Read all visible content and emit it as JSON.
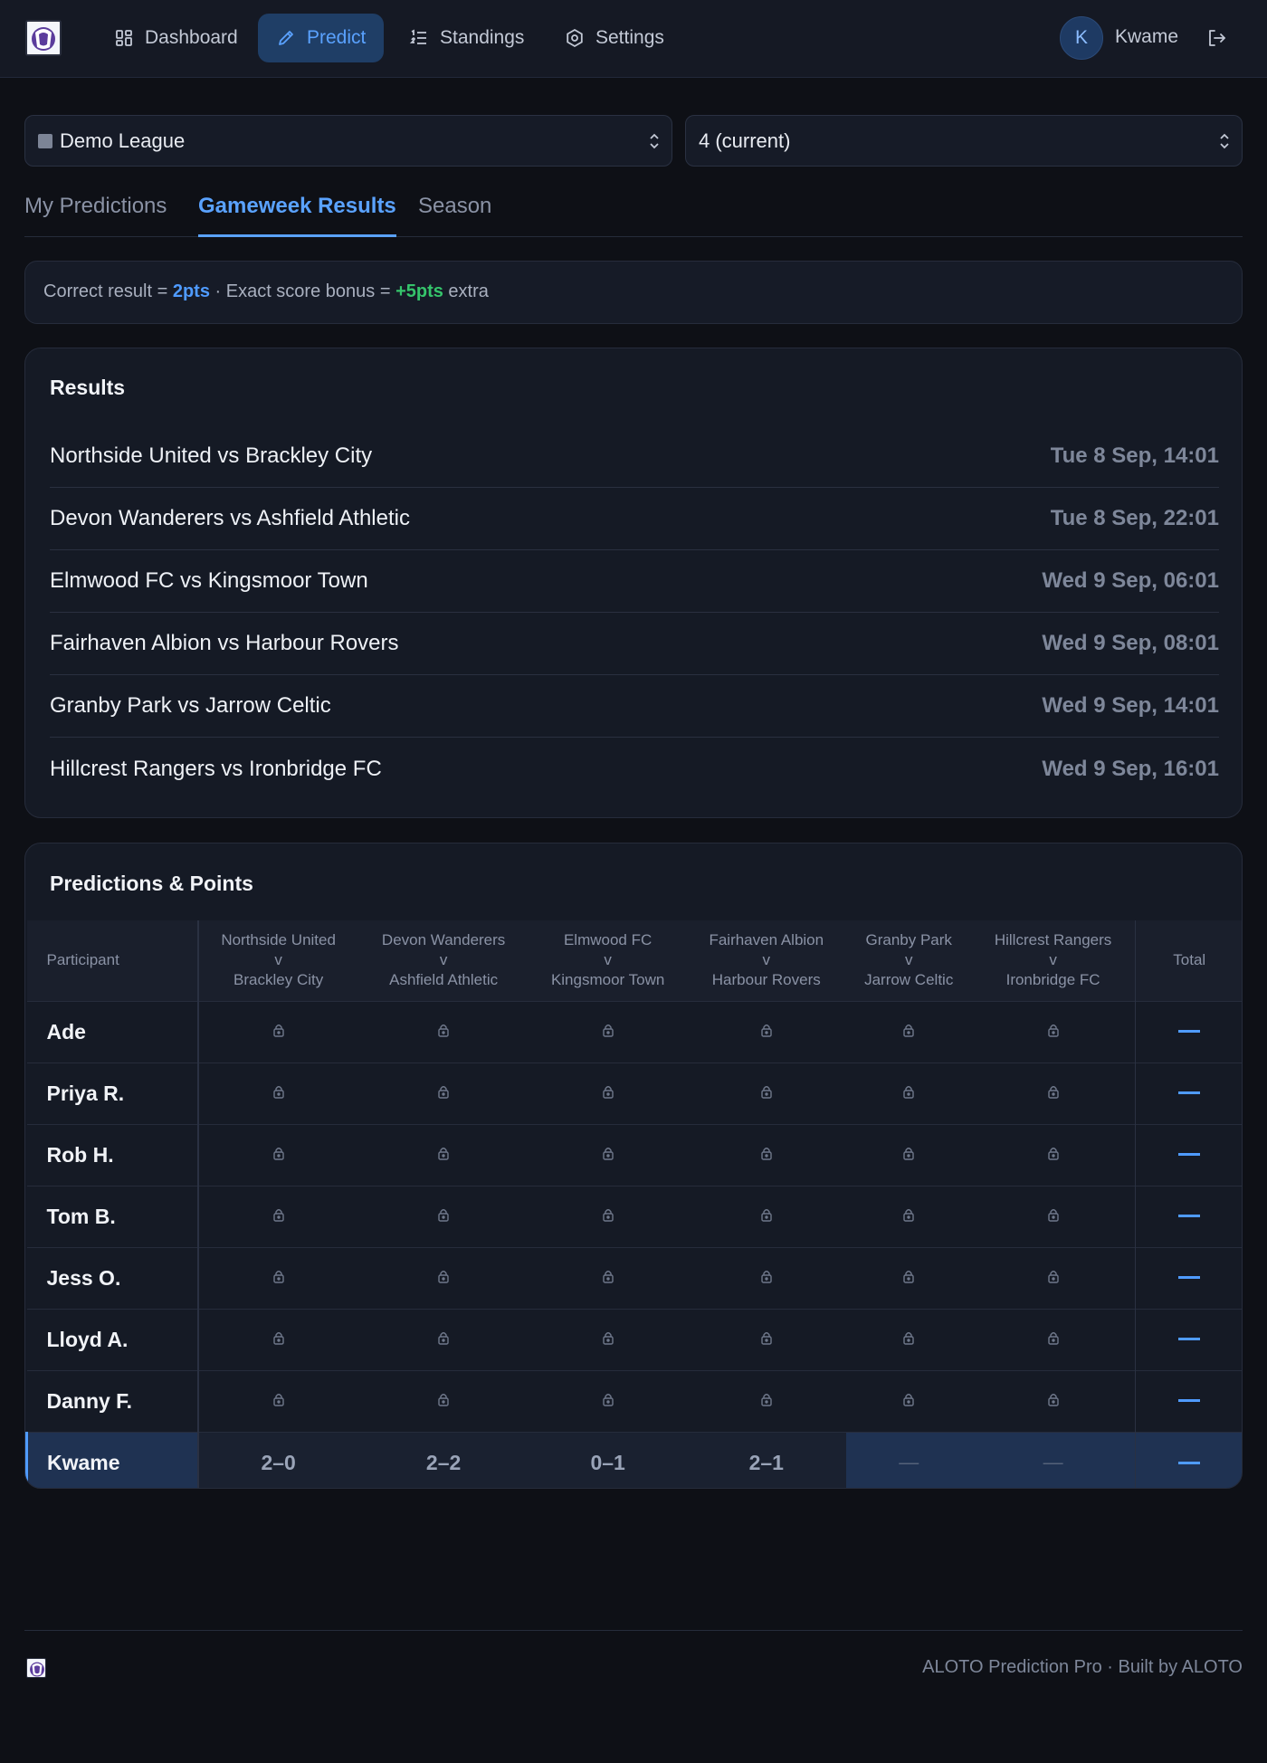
{
  "nav": {
    "items": [
      {
        "label": "Dashboard",
        "icon": "dashboard-icon"
      },
      {
        "label": "Predict",
        "icon": "pencil-icon",
        "active": true
      },
      {
        "label": "Standings",
        "icon": "list-ordered-icon"
      },
      {
        "label": "Settings",
        "icon": "gear-icon"
      }
    ],
    "user": {
      "initial": "K",
      "name": "Kwame"
    }
  },
  "filters": {
    "league": "Demo League",
    "gameweek": "4 (current)"
  },
  "tabs": [
    {
      "label": "My Predictions"
    },
    {
      "label": "Gameweek Results",
      "active": true
    },
    {
      "label": "Season"
    }
  ],
  "scoring": {
    "correct_label": "Correct result = ",
    "correct_pts": "2pts",
    "separator": " · ",
    "exact_label": "Exact score bonus = ",
    "exact_pts": "+5pts",
    "extra": " extra"
  },
  "results": {
    "title": "Results",
    "fixtures": [
      {
        "match": "Northside United vs Brackley City",
        "time": "Tue 8 Sep, 14:01"
      },
      {
        "match": "Devon Wanderers vs Ashfield Athletic",
        "time": "Tue 8 Sep, 22:01"
      },
      {
        "match": "Elmwood FC vs Kingsmoor Town",
        "time": "Wed 9 Sep, 06:01"
      },
      {
        "match": "Fairhaven Albion vs Harbour Rovers",
        "time": "Wed 9 Sep, 08:01"
      },
      {
        "match": "Granby Park vs Jarrow Celtic",
        "time": "Wed 9 Sep, 14:01"
      },
      {
        "match": "Hillcrest Rangers vs Ironbridge FC",
        "time": "Wed 9 Sep, 16:01"
      }
    ]
  },
  "predictions": {
    "title": "Predictions & Points",
    "participant_header": "Participant",
    "total_header": "Total",
    "columns": [
      {
        "home": "Northside United",
        "v": "v",
        "away": "Brackley City"
      },
      {
        "home": "Devon Wanderers",
        "v": "v",
        "away": "Ashfield Athletic"
      },
      {
        "home": "Elmwood FC",
        "v": "v",
        "away": "Kingsmoor Town"
      },
      {
        "home": "Fairhaven Albion",
        "v": "v",
        "away": "Harbour Rovers"
      },
      {
        "home": "Granby Park",
        "v": "v",
        "away": "Jarrow Celtic"
      },
      {
        "home": "Hillcrest Rangers",
        "v": "v",
        "away": "Ironbridge FC"
      }
    ],
    "locked_participants": [
      "Ade",
      "Priya R.",
      "Rob H.",
      "Tom B.",
      "Jess O.",
      "Lloyd A.",
      "Danny F."
    ],
    "current_user": {
      "name": "Kwame",
      "picks": [
        "2–0",
        "2–2",
        "0–1",
        "2–1",
        "—",
        "—"
      ],
      "total": "—"
    }
  },
  "footer": {
    "text": "ALOTO Prediction Pro · Built by ALOTO"
  },
  "colors": {
    "background": "#0e1016",
    "accent": "#4f9bff",
    "bonus": "#35c46b",
    "active_nav_bg": "#1f3e66"
  }
}
